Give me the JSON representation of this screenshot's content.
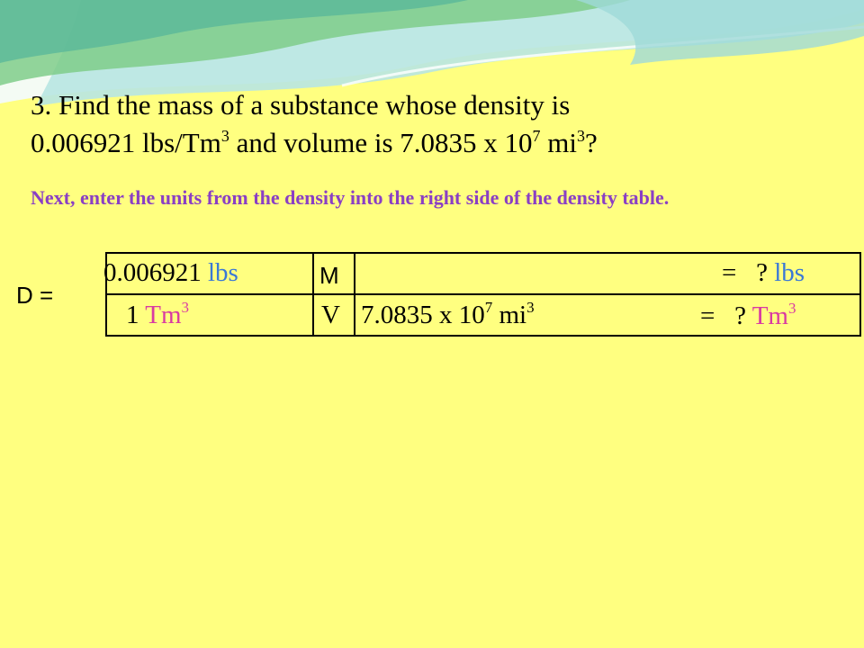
{
  "question": {
    "line1": "3.  Find the mass of a substance whose density is",
    "density_value": "0.006921 lbs/Tm",
    "density_exp": "3",
    "volume_text": "  and volume is 7.0835 x 10",
    "volume_exp_power": "7",
    "volume_unit": " mi",
    "volume_unit_exp": "3",
    "end": "?"
  },
  "instruction": "Next, enter the units from the density into the right side of the density table.",
  "density_label": "D =",
  "table": {
    "top_left_number": "0.006921 ",
    "top_left_unit": "lbs",
    "bottom_left_number": "1 ",
    "bottom_left_unit": "Tm",
    "bottom_left_exp": "3",
    "top_middle": "M",
    "bottom_middle": "V",
    "volume_value": "7.0835 x 10",
    "volume_power": "7",
    "volume_unit": "  mi",
    "volume_unit_exp": "3",
    "top_right_prefix": "=   ? ",
    "top_right_unit": "lbs",
    "bottom_right_prefix": "=   ? ",
    "bottom_right_unit": "Tm",
    "bottom_right_exp": "3"
  },
  "colors": {
    "background": "#ffff80",
    "instruction": "#8a3fc4",
    "lbs_unit": "#3a78d6",
    "tm_unit": "#d93aa2"
  }
}
